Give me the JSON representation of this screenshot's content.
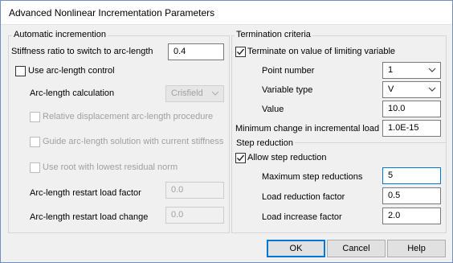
{
  "window": {
    "title": "Advanced Nonlinear Incrementation Parameters"
  },
  "auto": {
    "legend": "Automatic incremention",
    "stiffness_label": "Stiffness ratio to switch to arc-length",
    "stiffness_value": "0.4",
    "use_arc_label": "Use arc-length control",
    "arc_calc_label": "Arc-length calculation",
    "arc_calc_value": "Crisfield",
    "rel_disp_label": "Relative displacement arc-length procedure",
    "guide_label": "Guide arc-length solution with current stiffness",
    "root_label": "Use root with lowest residual norm",
    "restart_factor_label": "Arc-length restart load factor",
    "restart_factor_value": "0.0",
    "restart_change_label": "Arc-length restart load change",
    "restart_change_value": "0.0"
  },
  "term": {
    "legend": "Termination criteria",
    "terminate_label": "Terminate on value of limiting variable",
    "point_label": "Point number",
    "point_value": "1",
    "vartype_label": "Variable type",
    "vartype_value": "V",
    "value_label": "Value",
    "value_value": "10.0",
    "minchange_label": "Minimum change in incremental load",
    "minchange_value": "1.0E-15"
  },
  "step": {
    "legend": "Step reduction",
    "allow_label": "Allow step reduction",
    "maxred_label": "Maximum step reductions",
    "maxred_value": "5",
    "loadred_label": "Load reduction factor",
    "loadred_value": "0.5",
    "loadinc_label": "Load increase factor",
    "loadinc_value": "2.0"
  },
  "buttons": {
    "ok": "OK",
    "cancel": "Cancel",
    "help": "Help"
  }
}
